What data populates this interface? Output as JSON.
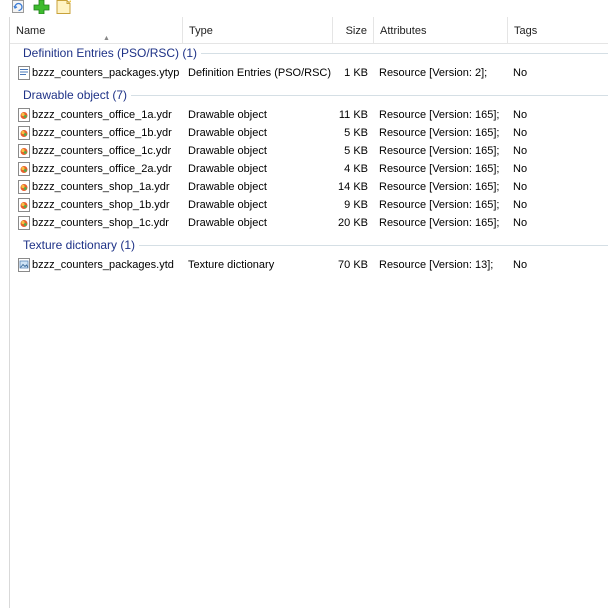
{
  "columns": {
    "name": "Name",
    "type": "Type",
    "size": "Size",
    "attributes": "Attributes",
    "tags": "Tags"
  },
  "toolbar": {
    "icons": [
      "refresh-icon",
      "add-icon",
      "new-file-icon"
    ]
  },
  "groups": [
    {
      "title": "Definition Entries (PSO/RSC) (1)",
      "icon": "ytyp-file-icon",
      "rows": [
        {
          "name": "bzzz_counters_packages.ytyp",
          "type": "Definition Entries (PSO/RSC)",
          "size": "1 KB",
          "attributes": "Resource [Version: 2];",
          "tags": "No"
        }
      ]
    },
    {
      "title": "Drawable object (7)",
      "icon": "ydr-file-icon",
      "rows": [
        {
          "name": "bzzz_counters_office_1a.ydr",
          "type": "Drawable object",
          "size": "11 KB",
          "attributes": "Resource [Version: 165];",
          "tags": "No"
        },
        {
          "name": "bzzz_counters_office_1b.ydr",
          "type": "Drawable object",
          "size": "5 KB",
          "attributes": "Resource [Version: 165];",
          "tags": "No"
        },
        {
          "name": "bzzz_counters_office_1c.ydr",
          "type": "Drawable object",
          "size": "5 KB",
          "attributes": "Resource [Version: 165];",
          "tags": "No"
        },
        {
          "name": "bzzz_counters_office_2a.ydr",
          "type": "Drawable object",
          "size": "4 KB",
          "attributes": "Resource [Version: 165];",
          "tags": "No"
        },
        {
          "name": "bzzz_counters_shop_1a.ydr",
          "type": "Drawable object",
          "size": "14 KB",
          "attributes": "Resource [Version: 165];",
          "tags": "No"
        },
        {
          "name": "bzzz_counters_shop_1b.ydr",
          "type": "Drawable object",
          "size": "9 KB",
          "attributes": "Resource [Version: 165];",
          "tags": "No"
        },
        {
          "name": "bzzz_counters_shop_1c.ydr",
          "type": "Drawable object",
          "size": "20 KB",
          "attributes": "Resource [Version: 165];",
          "tags": "No"
        }
      ]
    },
    {
      "title": "Texture dictionary (1)",
      "icon": "ytd-file-icon",
      "rows": [
        {
          "name": "bzzz_counters_packages.ytd",
          "type": "Texture dictionary",
          "size": "70 KB",
          "attributes": "Resource [Version: 13];",
          "tags": "No"
        }
      ]
    }
  ]
}
